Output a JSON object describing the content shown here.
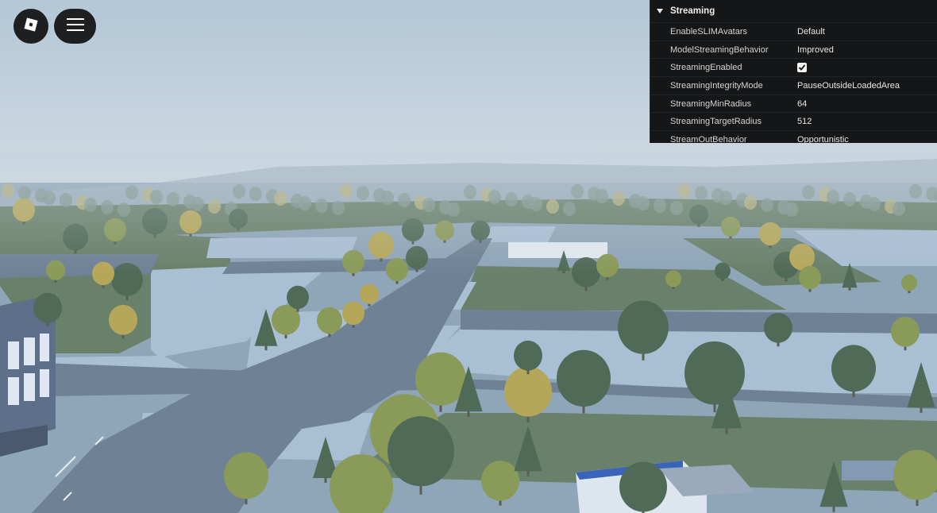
{
  "top_buttons": {
    "logo_icon": "roblox-logo-icon",
    "menu_icon": "hamburger-menu-icon"
  },
  "properties_panel": {
    "section_title": "Streaming",
    "rows": [
      {
        "name": "EnableSLIMAvatars",
        "value": "Default"
      },
      {
        "name": "ModelStreamingBehavior",
        "value": "Improved"
      },
      {
        "name": "StreamingEnabled",
        "value": "",
        "checked": true
      },
      {
        "name": "StreamingIntegrityMode",
        "value": "PauseOutsideLoadedArea"
      },
      {
        "name": "StreamingMinRadius",
        "value": "64"
      },
      {
        "name": "StreamingTargetRadius",
        "value": "512"
      },
      {
        "name": "StreamOutBehavior",
        "value": "Opportunistic"
      }
    ]
  },
  "colors": {
    "sky": "#c6d6e2",
    "road": "#6f8295",
    "sidewalk": "#a9bfd3",
    "grass": "#69806a",
    "tree_dark": "#4f6b57",
    "tree_olive": "#8a9a58",
    "tree_yellow": "#b5a75a",
    "panel_bg": "#151617"
  }
}
